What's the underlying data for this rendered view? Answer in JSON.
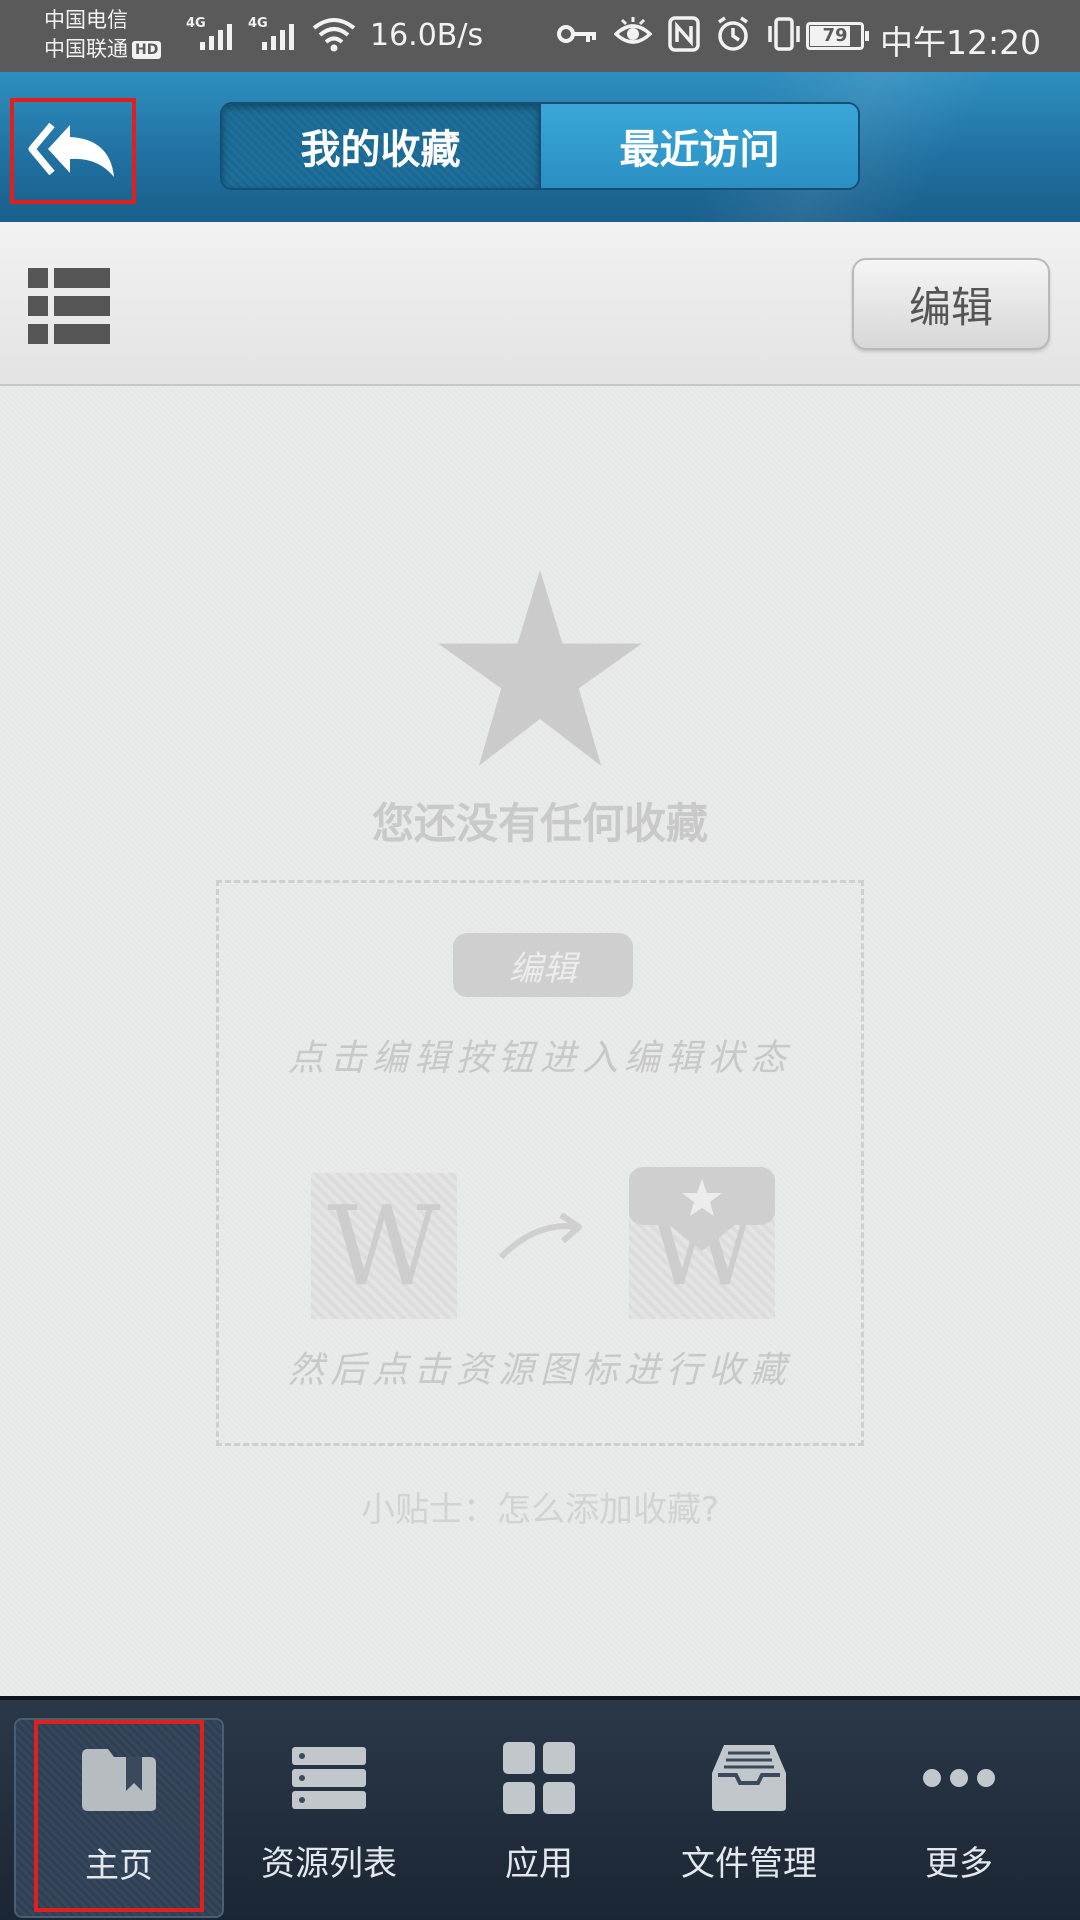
{
  "status_bar": {
    "carrier_1": "中国电信",
    "carrier_2": "中国联通",
    "hd_badge": "HD",
    "signal_1_tag": "4G",
    "signal_2_tag": "4G",
    "net_speed": "16.0B/s",
    "battery_level": "79",
    "time": "中午12:20",
    "icons": [
      "key-icon",
      "eye-icon",
      "nfc-icon",
      "alarm-icon",
      "vibrate-icon"
    ]
  },
  "header": {
    "back_icon": "double-reply-arrow-icon",
    "tabs": [
      {
        "label": "我的收藏",
        "active": true
      },
      {
        "label": "最近访问",
        "active": false
      }
    ]
  },
  "toolbar": {
    "list_icon": "list-view-icon",
    "edit_label": "编辑"
  },
  "empty_state": {
    "star_icon": "star-icon",
    "title": "您还没有任何收藏",
    "tip": {
      "edit_chip": "编辑",
      "line_1": "点击编辑按钮进入编辑状态",
      "tile_letter_left": "W",
      "tile_letter_right": "W",
      "line_2": "然后点击资源图标进行收藏"
    },
    "help_link": "小贴士：怎么添加收藏?"
  },
  "bottom_nav": {
    "items": [
      {
        "label": "主页",
        "icon": "bookmark-folder-icon",
        "active": true
      },
      {
        "label": "资源列表",
        "icon": "server-list-icon",
        "active": false
      },
      {
        "label": "应用",
        "icon": "apps-grid-icon",
        "active": false
      },
      {
        "label": "文件管理",
        "icon": "file-tray-icon",
        "active": false
      },
      {
        "label": "更多",
        "icon": "more-dots-icon",
        "active": false
      }
    ]
  },
  "colors": {
    "header_blue": "#1f6f9f",
    "highlight_red": "#e0201e",
    "nav_dark": "#1b2634"
  }
}
